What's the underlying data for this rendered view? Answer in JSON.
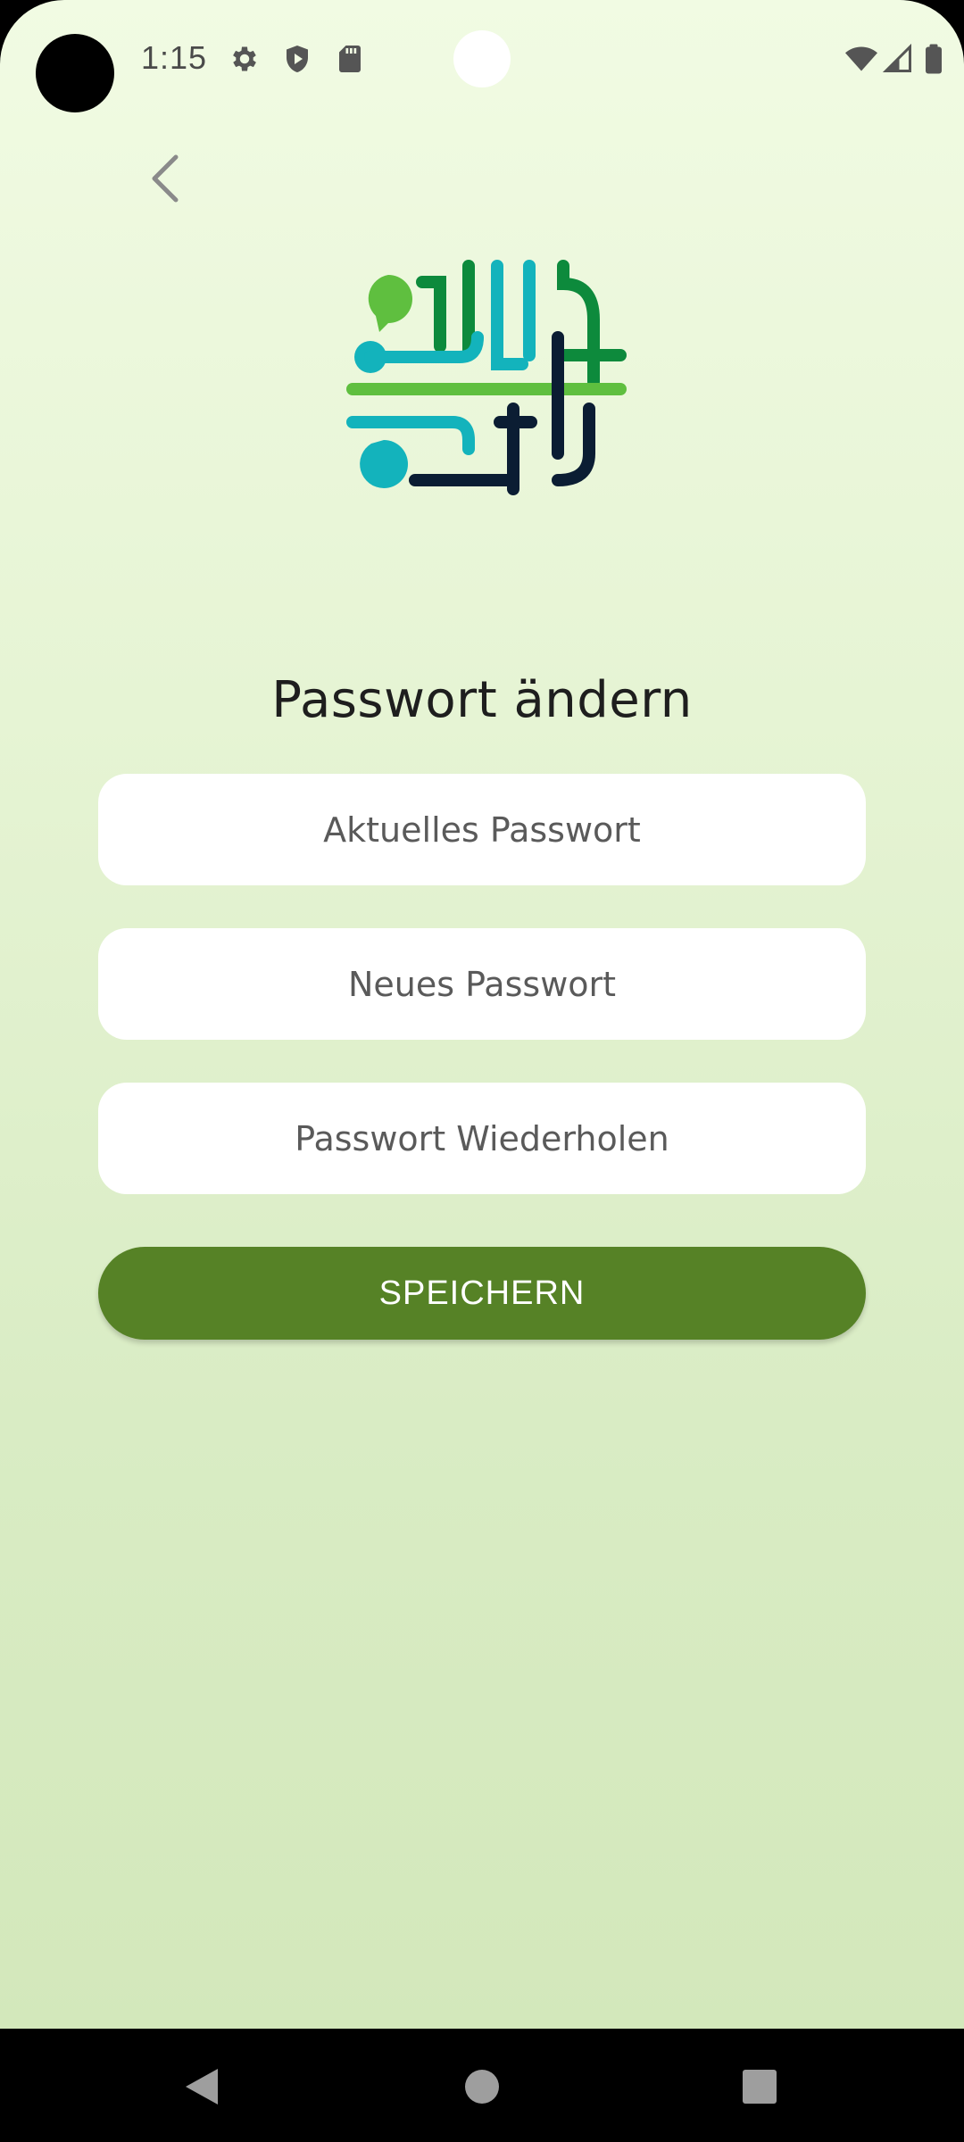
{
  "status_bar": {
    "time": "1:15",
    "left_icons": [
      "gear-icon",
      "shield-play-icon",
      "sd-card-icon"
    ],
    "right_icons": [
      "wifi-icon",
      "signal-icon",
      "battery-icon"
    ]
  },
  "header": {
    "back_icon": "chevron-left-icon"
  },
  "title": "Passwort ändern",
  "form": {
    "current_password": {
      "value": "",
      "placeholder": "Aktuelles Passwort"
    },
    "new_password": {
      "value": "",
      "placeholder": "Neues Passwort"
    },
    "repeat_password": {
      "value": "",
      "placeholder": "Passwort Wiederholen"
    },
    "save_label": "SPEICHERN"
  },
  "navigation": {
    "icons": [
      "nav-back-icon",
      "nav-home-icon",
      "nav-recents-icon"
    ]
  },
  "colors": {
    "accent": "#568226",
    "background_top": "#f1fbe3",
    "background_bottom": "#d3e8bb",
    "field": "#ffffff",
    "nav_bar": "#000000",
    "logo_dark_green": "#0d8a3c",
    "logo_light_green": "#5fbf3f",
    "logo_teal": "#13b3bc",
    "logo_navy": "#0b1d33"
  }
}
